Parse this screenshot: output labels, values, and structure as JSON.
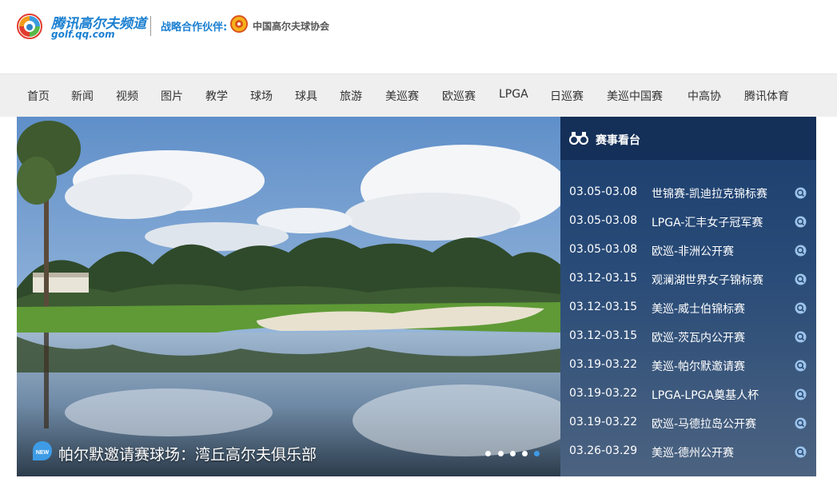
{
  "header": {
    "logo_title": "腾讯高尔夫频道",
    "logo_domain": "golf.qq.com",
    "partner_label": "战略合作伙伴:",
    "partner_name": "中国高尔夫球协会"
  },
  "nav": {
    "items": [
      "首页",
      "新闻",
      "视频",
      "图片",
      "教学",
      "球场",
      "球具",
      "旅游",
      "美巡赛",
      "欧巡赛",
      "LPGA",
      "日巡赛",
      "美巡中国赛",
      "中高协",
      "腾讯体育"
    ]
  },
  "hero": {
    "caption": "帕尔默邀请赛球场：湾丘高尔夫俱乐部",
    "badge_text": "NEW",
    "slides_total": 5,
    "active_slide": 5
  },
  "schedule": {
    "title": "赛事看台",
    "events": [
      {
        "date": "03.05-03.08",
        "name": "世锦赛-凯迪拉克锦标赛"
      },
      {
        "date": "03.05-03.08",
        "name": "LPGA-汇丰女子冠军赛"
      },
      {
        "date": "03.05-03.08",
        "name": "欧巡-非洲公开赛"
      },
      {
        "date": "03.12-03.15",
        "name": "观澜湖世界女子锦标赛"
      },
      {
        "date": "03.12-03.15",
        "name": "美巡-威士伯锦标赛"
      },
      {
        "date": "03.12-03.15",
        "name": "欧巡-茨瓦内公开赛"
      },
      {
        "date": "03.19-03.22",
        "name": "美巡-帕尔默邀请赛"
      },
      {
        "date": "03.19-03.22",
        "name": "LPGA-LPGA奠基人杯"
      },
      {
        "date": "03.19-03.22",
        "name": "欧巡-马德拉岛公开赛"
      },
      {
        "date": "03.26-03.29",
        "name": "美巡-德州公开赛"
      }
    ]
  },
  "colors": {
    "brand_blue": "#1a7fd1",
    "panel_head": "#142f58",
    "dot_active": "#3e9be6"
  }
}
